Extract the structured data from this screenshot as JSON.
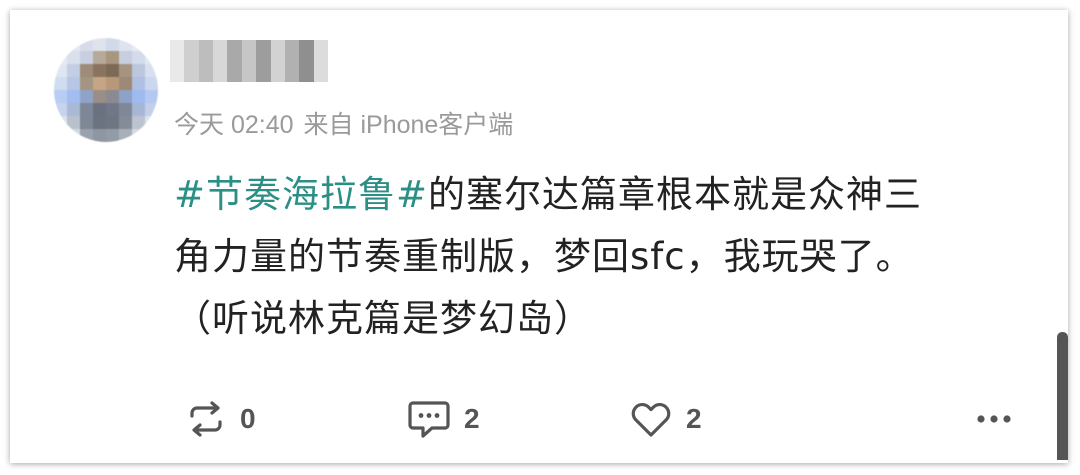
{
  "post": {
    "meta": {
      "time": "今天 02:40",
      "source": "来自 iPhone客户端"
    },
    "content": {
      "hashtag": "#节奏海拉鲁#",
      "line1_rest": "的塞尔达篇章根本就是众神三",
      "line2": "角力量的节奏重制版，梦回sfc，我玩哭了。",
      "line3": "（听说林克篇是梦幻岛）"
    },
    "actions": {
      "repost_count": "0",
      "comment_count": "2",
      "like_count": "2"
    }
  },
  "colors": {
    "hashtag": "#2b8f86",
    "meta": "#9a9a9a",
    "text": "#222222",
    "icon": "#555555"
  }
}
